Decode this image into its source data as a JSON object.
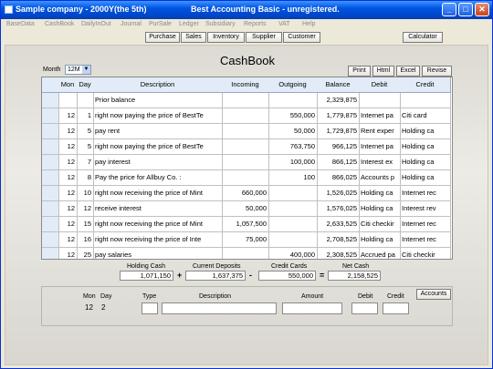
{
  "window": {
    "title_left": "Sample company - 2000Y(the 5th)",
    "title_center": "Best Accounting Basic  -  unregistered."
  },
  "menu": [
    "BaseData",
    "CashBook",
    "DailyInOut",
    "Journal",
    "PurSale",
    "Ledger",
    "Subsidiary",
    "Reports",
    "VAT",
    "Help"
  ],
  "toolbar": [
    "Purchase",
    "Sales",
    "Inventory",
    "Supplier",
    "Customer"
  ],
  "calculator_label": "Calculator",
  "page_title": "CashBook",
  "month": {
    "label": "Month",
    "value": "12M"
  },
  "actions": [
    "Print",
    "Html",
    "Excel",
    "Revise"
  ],
  "table": {
    "columns": [
      "Mon",
      "Day",
      "Description",
      "Incoming",
      "Outgoing",
      "Balance",
      "Debit",
      "Credit"
    ],
    "rows": [
      {
        "mon": "",
        "day": "",
        "desc": "Prior balance",
        "in": "",
        "out": "",
        "bal": "2,329,875",
        "debit": "",
        "credit": ""
      },
      {
        "mon": "12",
        "day": "1",
        "desc": "right now paying the price of BestTe",
        "in": "",
        "out": "550,000",
        "bal": "1,779,875",
        "debit": "Internet pa",
        "credit": "Citi card"
      },
      {
        "mon": "12",
        "day": "5",
        "desc": "pay rent",
        "in": "",
        "out": "50,000",
        "bal": "1,729,875",
        "debit": "Rent exper",
        "credit": "Holding ca"
      },
      {
        "mon": "12",
        "day": "5",
        "desc": "right now paying the price of BestTe",
        "in": "",
        "out": "763,750",
        "bal": "966,125",
        "debit": "Internet pa",
        "credit": "Holding ca"
      },
      {
        "mon": "12",
        "day": "7",
        "desc": "pay interest",
        "in": "",
        "out": "100,000",
        "bal": "866,125",
        "debit": "Interest ex",
        "credit": "Holding ca"
      },
      {
        "mon": "12",
        "day": "8",
        "desc": "Pay the price for Allbuy Co. :",
        "in": "",
        "out": "100",
        "bal": "866,025",
        "debit": "Accounts p",
        "credit": "Holding ca"
      },
      {
        "mon": "12",
        "day": "10",
        "desc": "right now receiving the price of Mint",
        "in": "660,000",
        "out": "",
        "bal": "1,526,025",
        "debit": "Holding ca",
        "credit": "Internet rec"
      },
      {
        "mon": "12",
        "day": "12",
        "desc": "receive interest",
        "in": "50,000",
        "out": "",
        "bal": "1,576,025",
        "debit": "Holding ca",
        "credit": "Interest rev"
      },
      {
        "mon": "12",
        "day": "15",
        "desc": "right now receiving the price of Mint",
        "in": "1,057,500",
        "out": "",
        "bal": "2,633,525",
        "debit": "Citi checkir",
        "credit": "Internet rec"
      },
      {
        "mon": "12",
        "day": "16",
        "desc": "right now receiving the price of  Inte",
        "in": "75,000",
        "out": "",
        "bal": "2,708,525",
        "debit": "Holding ca",
        "credit": "Internet rec"
      },
      {
        "mon": "12",
        "day": "25",
        "desc": "pay salaries",
        "in": "",
        "out": "400,000",
        "bal": "2,308,525",
        "debit": "Accrued pa",
        "credit": "Citi checkir"
      },
      {
        "mon": "12",
        "day": "30",
        "desc": "purchase treasury stock",
        "in": "",
        "out": "150,000",
        "bal": "2,158,525",
        "debit": "Treasury s",
        "credit": "Holding ca"
      }
    ]
  },
  "totals": {
    "holding_cash": {
      "label": "Holding Cash",
      "value": "1,071,150"
    },
    "current_deposits": {
      "label": "Current Deposits",
      "value": "1,637,375"
    },
    "credit_cards": {
      "label": "Credit Cards",
      "value": "550,000"
    },
    "net_cash": {
      "label": "Net Cash",
      "value": "2,158,525"
    },
    "op_plus": "+",
    "op_minus": "-",
    "op_equals": "="
  },
  "entry": {
    "mon_label": "Mon",
    "day_label": "Day",
    "type_label": "Type",
    "desc_label": "Description",
    "amount_label": "Amount",
    "debit_label": "Debit",
    "credit_label": "Credit",
    "mon_value": "12",
    "day_value": "2",
    "accounts_button": "Accounts"
  },
  "colors": {
    "titlebar": "#0054e3",
    "header_bg": "#e2ecf8",
    "window_bg": "#ece9d8"
  }
}
